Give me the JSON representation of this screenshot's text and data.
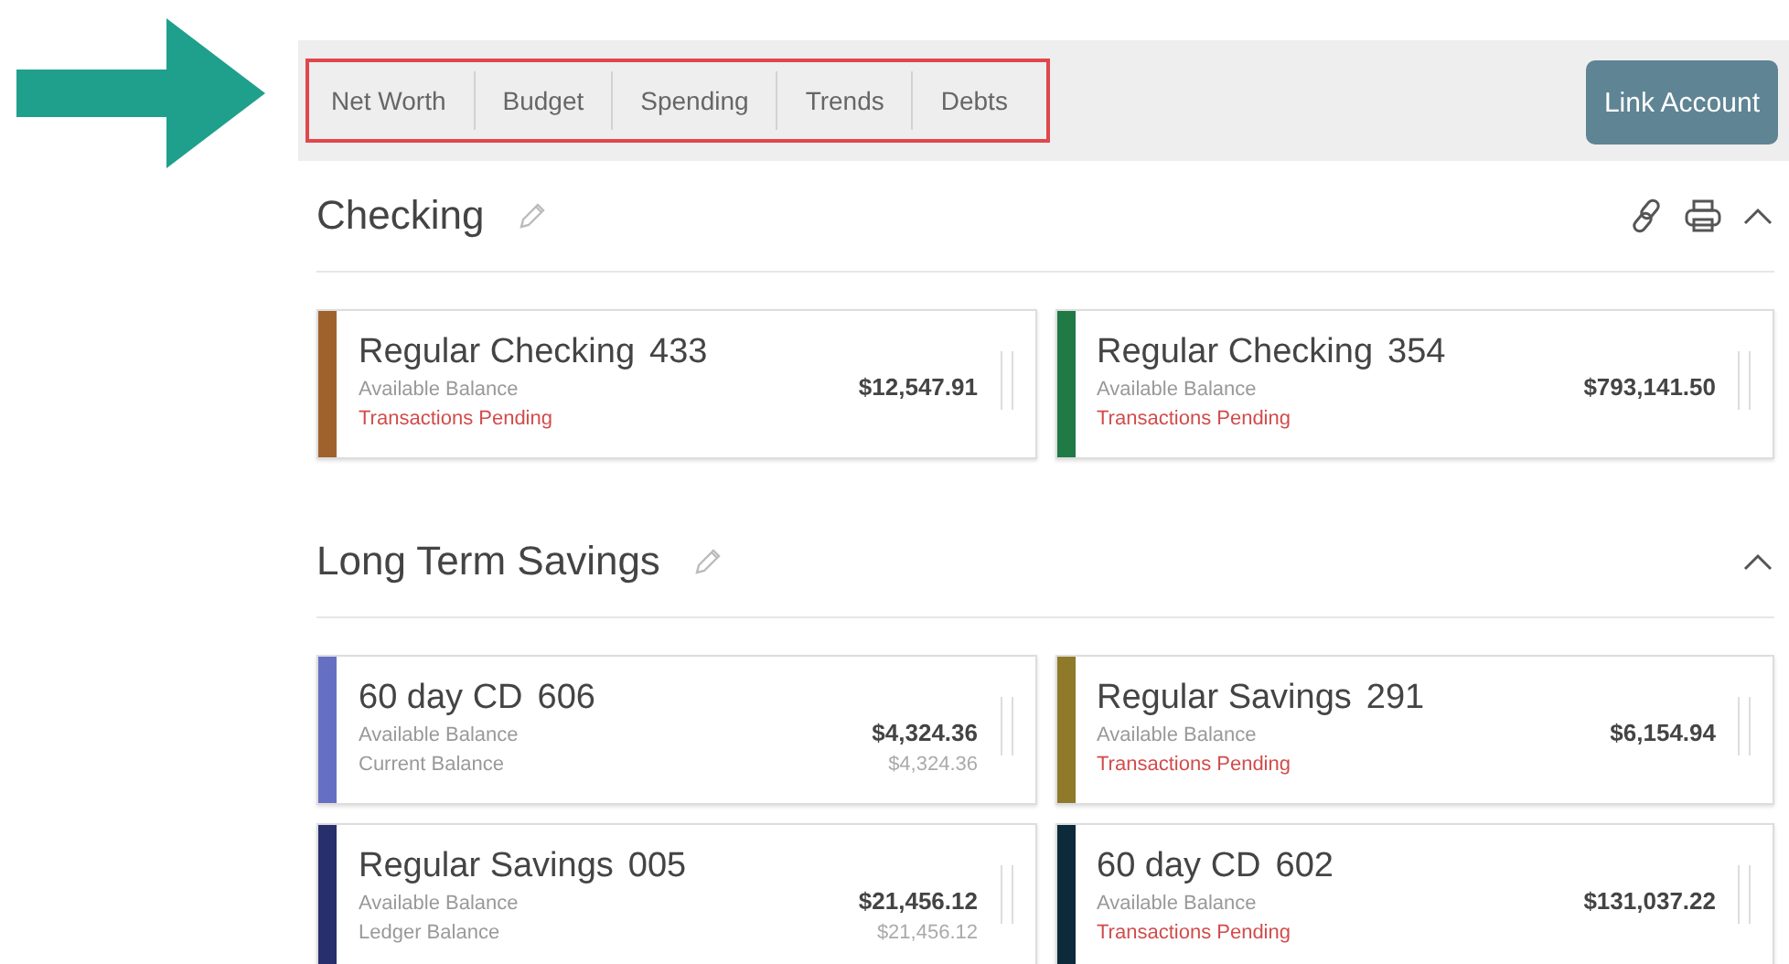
{
  "tabs_highlighted": true,
  "tabs": [
    {
      "label": "Net Worth"
    },
    {
      "label": "Budget"
    },
    {
      "label": "Spending"
    },
    {
      "label": "Trends"
    },
    {
      "label": "Debts"
    }
  ],
  "link_button": "Link Account",
  "sections": [
    {
      "title": "Checking",
      "actions": true,
      "expanded": true,
      "accounts": [
        {
          "name": "Regular Checking",
          "number": "433",
          "color": "#a0622c",
          "label1": "Available Balance",
          "amount": "$12,547.91",
          "line2": {
            "kind": "pending",
            "text": "Transactions Pending"
          }
        },
        {
          "name": "Regular Checking",
          "number": "354",
          "color": "#1f7a46",
          "label1": "Available Balance",
          "amount": "$793,141.50",
          "line2": {
            "kind": "pending",
            "text": "Transactions Pending"
          }
        }
      ]
    },
    {
      "title": "Long Term Savings",
      "actions": false,
      "expanded": true,
      "accounts": [
        {
          "name": "60 day CD",
          "number": "606",
          "color": "#6670c2",
          "label1": "Available Balance",
          "amount": "$4,324.36",
          "line2": {
            "kind": "balance",
            "text": "Current Balance",
            "amount": "$4,324.36"
          }
        },
        {
          "name": "Regular Savings",
          "number": "291",
          "color": "#8f7a2a",
          "label1": "Available Balance",
          "amount": "$6,154.94",
          "line2": {
            "kind": "pending",
            "text": "Transactions Pending"
          }
        },
        {
          "name": "Regular Savings",
          "number": "005",
          "color": "#27306a",
          "label1": "Available Balance",
          "amount": "$21,456.12",
          "line2": {
            "kind": "balance",
            "text": "Ledger Balance",
            "amount": "$21,456.12"
          }
        },
        {
          "name": "60 day CD",
          "number": "602",
          "color": "#0d2a3a",
          "label1": "Available Balance",
          "amount": "$131,037.22",
          "line2": {
            "kind": "pending",
            "text": "Transactions Pending"
          }
        }
      ]
    }
  ]
}
